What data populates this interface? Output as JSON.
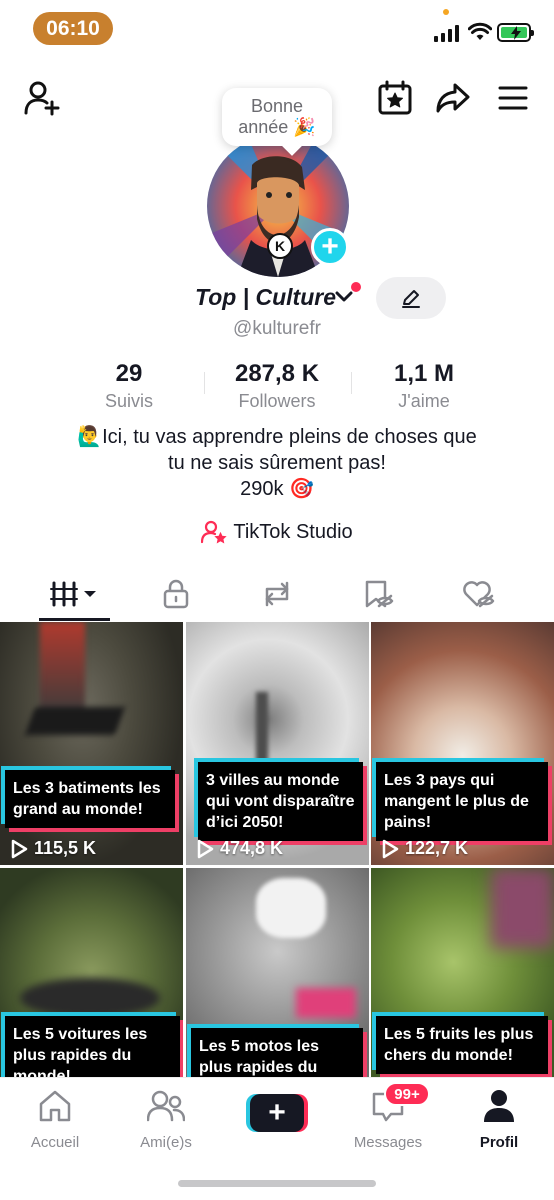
{
  "status_bar": {
    "time": "06:10"
  },
  "bubble": {
    "line1": "Bonne",
    "line2": "année 🎉"
  },
  "profile": {
    "display_name": "Top | Culture",
    "username": "@kulturefr",
    "avatar_badge": "K"
  },
  "stats": [
    {
      "value": "29",
      "label": "Suivis"
    },
    {
      "value": "287,8 K",
      "label": "Followers"
    },
    {
      "value": "1,1 M",
      "label": "J'aime"
    }
  ],
  "bio": {
    "line1": "🙋‍♂️Ici, tu vas apprendre pleins de choses que",
    "line2": "tu ne sais sûrement pas!",
    "line3": "290k 🎯"
  },
  "studio_link": "TikTok Studio",
  "videos": [
    {
      "caption": "Les 3 batiments les grand au monde!",
      "views": "115,5 K"
    },
    {
      "caption": "3 villes au monde qui vont disparaître d’ici 2050!",
      "views": "474,8 K"
    },
    {
      "caption": "Les 3 pays qui mangent le plus de pains!",
      "views": "122,7 K"
    },
    {
      "caption": "Les 5 voitures les plus rapides du monde!",
      "views": ""
    },
    {
      "caption": "Les 5 motos les plus rapides du monde!",
      "views": ""
    },
    {
      "caption": "Les 5 fruits les plus chers du monde!",
      "views": ""
    }
  ],
  "bottom_nav": {
    "home": "Accueil",
    "friends": "Ami(e)s",
    "create": "+",
    "messages": "Messages",
    "messages_badge": "99+",
    "profile": "Profil"
  },
  "colors": {
    "accent_red": "#fe2c55",
    "accent_cyan": "#29c6e0",
    "time_pill": "#c8802e"
  }
}
